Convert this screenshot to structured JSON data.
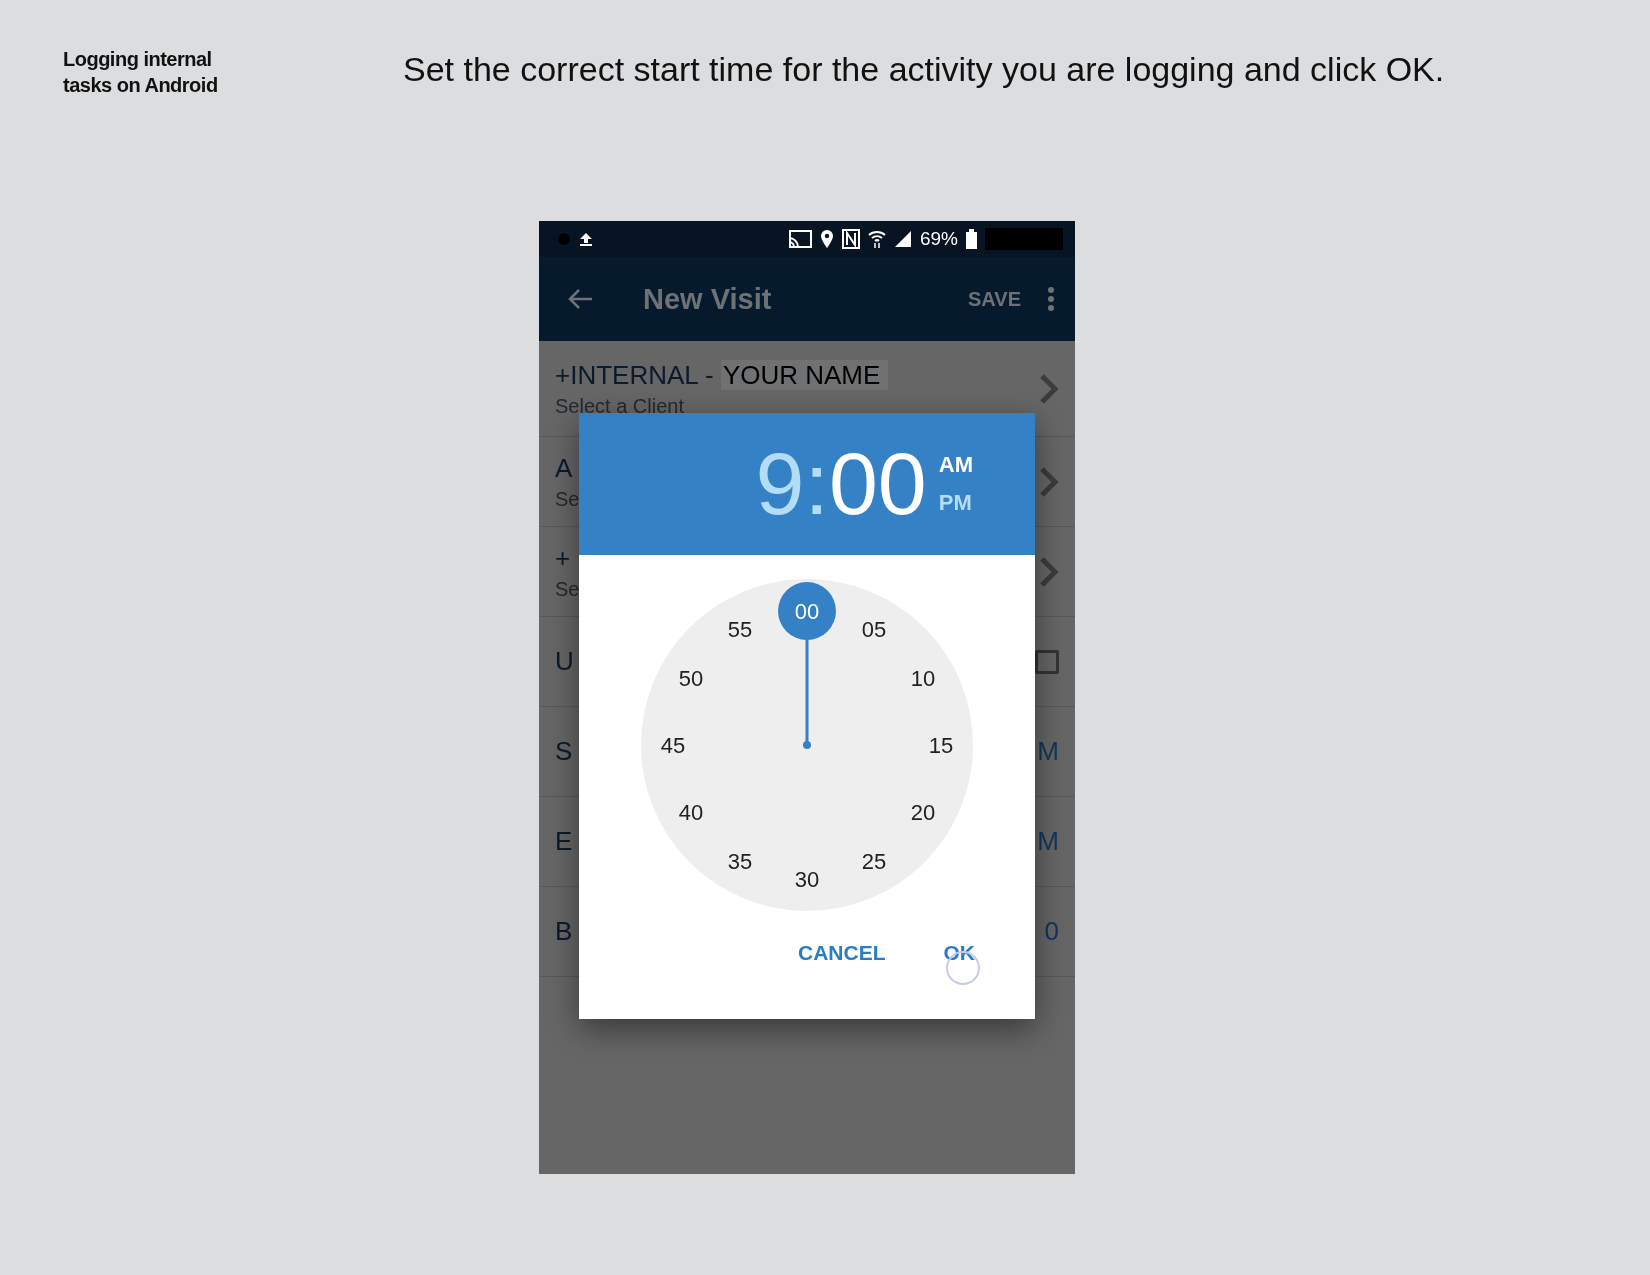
{
  "guide": {
    "title": "Logging internal tasks on Android",
    "instruction": "Set the correct start time for the activity you are logging and click OK."
  },
  "status_bar": {
    "battery": "69%"
  },
  "app_bar": {
    "title": "New Visit",
    "action": "SAVE"
  },
  "rows": [
    {
      "kind": "select",
      "title": "+INTERNAL - ",
      "title_highlight": "YOUR NAME",
      "subtitle": "Select a Client"
    },
    {
      "kind": "select",
      "title": "A",
      "subtitle": "Se"
    },
    {
      "kind": "select",
      "title": "+",
      "subtitle": "Se"
    },
    {
      "kind": "checkbox",
      "title": "U",
      "checked": false
    },
    {
      "kind": "value",
      "title": "S",
      "value": "M"
    },
    {
      "kind": "value",
      "title": "E",
      "value": "M"
    },
    {
      "kind": "value",
      "title": "B",
      "value": "0"
    }
  ],
  "dialog": {
    "hour": {
      "text": "9",
      "selected": false
    },
    "separator": ":",
    "minute": {
      "text": "00",
      "selected": true
    },
    "periods": [
      {
        "label": "AM",
        "selected": true
      },
      {
        "label": "PM",
        "selected": false
      }
    ],
    "dial": [
      {
        "label": "00",
        "selected": true
      },
      {
        "label": "05",
        "selected": false
      },
      {
        "label": "10",
        "selected": false
      },
      {
        "label": "15",
        "selected": false
      },
      {
        "label": "20",
        "selected": false
      },
      {
        "label": "25",
        "selected": false
      },
      {
        "label": "30",
        "selected": false
      },
      {
        "label": "35",
        "selected": false
      },
      {
        "label": "40",
        "selected": false
      },
      {
        "label": "45",
        "selected": false
      },
      {
        "label": "50",
        "selected": false
      },
      {
        "label": "55",
        "selected": false
      }
    ],
    "buttons": [
      "CANCEL",
      "OK"
    ]
  }
}
